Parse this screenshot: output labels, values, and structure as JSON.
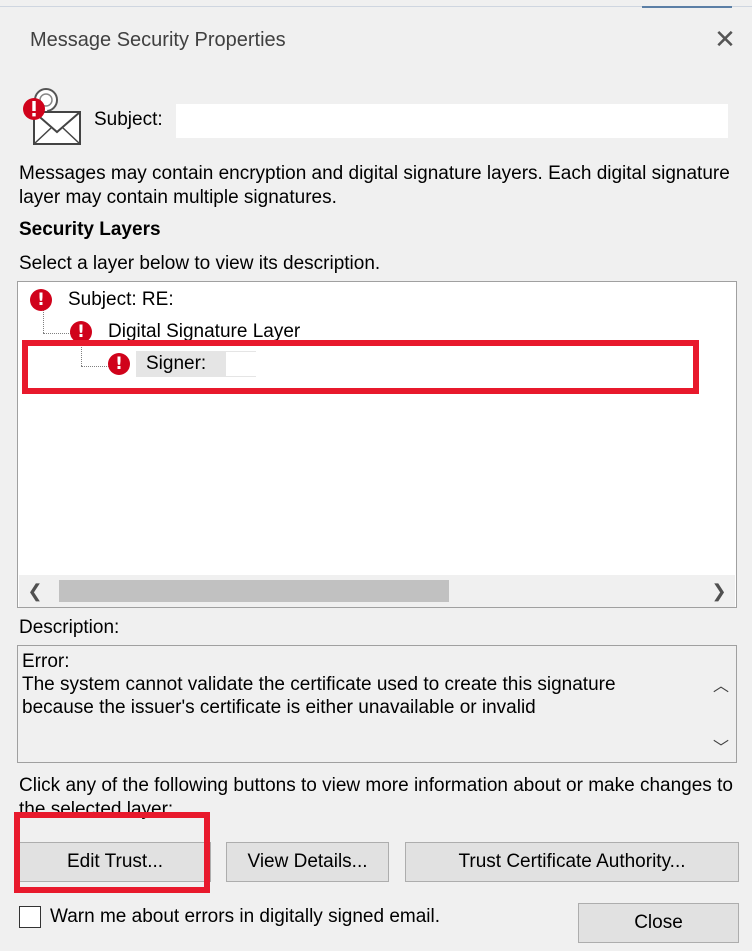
{
  "dialog": {
    "title": "Message Security Properties"
  },
  "header": {
    "subject_label": "Subject:"
  },
  "intro_text": "Messages may contain encryption and digital signature layers. Each digital signature layer may contain multiple signatures.",
  "security_layers": {
    "heading": "Security Layers",
    "instruction": "Select a layer below to view its description.",
    "tree": [
      {
        "label": "Subject: RE:",
        "icon": "error-icon"
      },
      {
        "label": "Digital Signature Layer",
        "icon": "error-icon"
      },
      {
        "label": "Signer:",
        "icon": "error-icon"
      }
    ]
  },
  "description": {
    "label": "Description:",
    "text": "Error:\nThe system cannot validate the certificate used to create this signature because the issuer's certificate is either unavailable or invalid"
  },
  "buttons_intro": "Click any of the following buttons to view more information about or make changes to the selected layer:",
  "buttons": {
    "edit_trust": "Edit Trust...",
    "view_details": "View Details...",
    "trust_ca": "Trust Certificate Authority...",
    "close": "Close"
  },
  "warn_checkbox": {
    "label": "Warn me about errors in digitally signed email.",
    "checked": false
  },
  "colors": {
    "error_red": "#d0021b",
    "highlight_box": "#e8192c"
  }
}
